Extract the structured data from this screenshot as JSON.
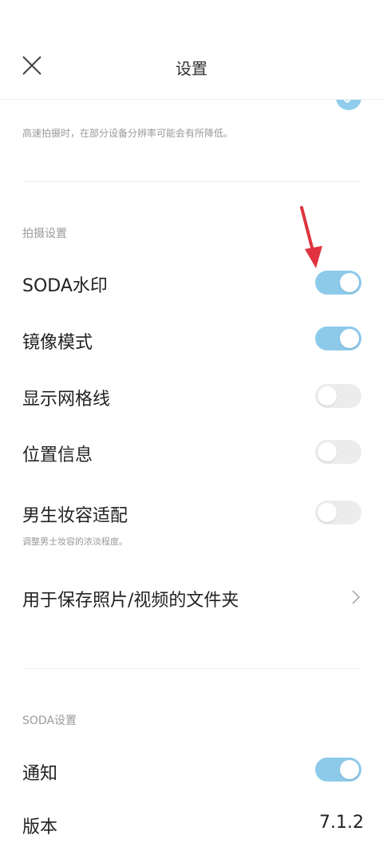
{
  "header": {
    "title": "设置"
  },
  "top_section": {
    "note": "高速拍摄时，在部分设备分辨率可能会有所降低。"
  },
  "shooting_settings": {
    "section_label": "拍摄设置",
    "items": [
      {
        "label": "SODA水印",
        "enabled": true
      },
      {
        "label": "镜像模式",
        "enabled": true
      },
      {
        "label": "显示网格线",
        "enabled": false
      },
      {
        "label": "位置信息",
        "enabled": false
      },
      {
        "label": "男生妆容适配",
        "enabled": false,
        "note": "调整男士妆容的浓淡程度。"
      }
    ],
    "folder_item": {
      "label": "用于保存照片/视频的文件夹"
    }
  },
  "soda_settings": {
    "section_label": "SODA设置",
    "notification": {
      "label": "通知",
      "enabled": true
    },
    "version": {
      "label": "版本",
      "value": "7.1.2"
    }
  },
  "colors": {
    "toggle_on": "#8dcaea",
    "toggle_off": "#ececec",
    "annotation_arrow": "#e0333f"
  },
  "icons": {
    "close": "close-icon",
    "check": "check-icon",
    "chevron": "chevron-right-icon",
    "arrow": "red-arrow-annotation-icon"
  }
}
